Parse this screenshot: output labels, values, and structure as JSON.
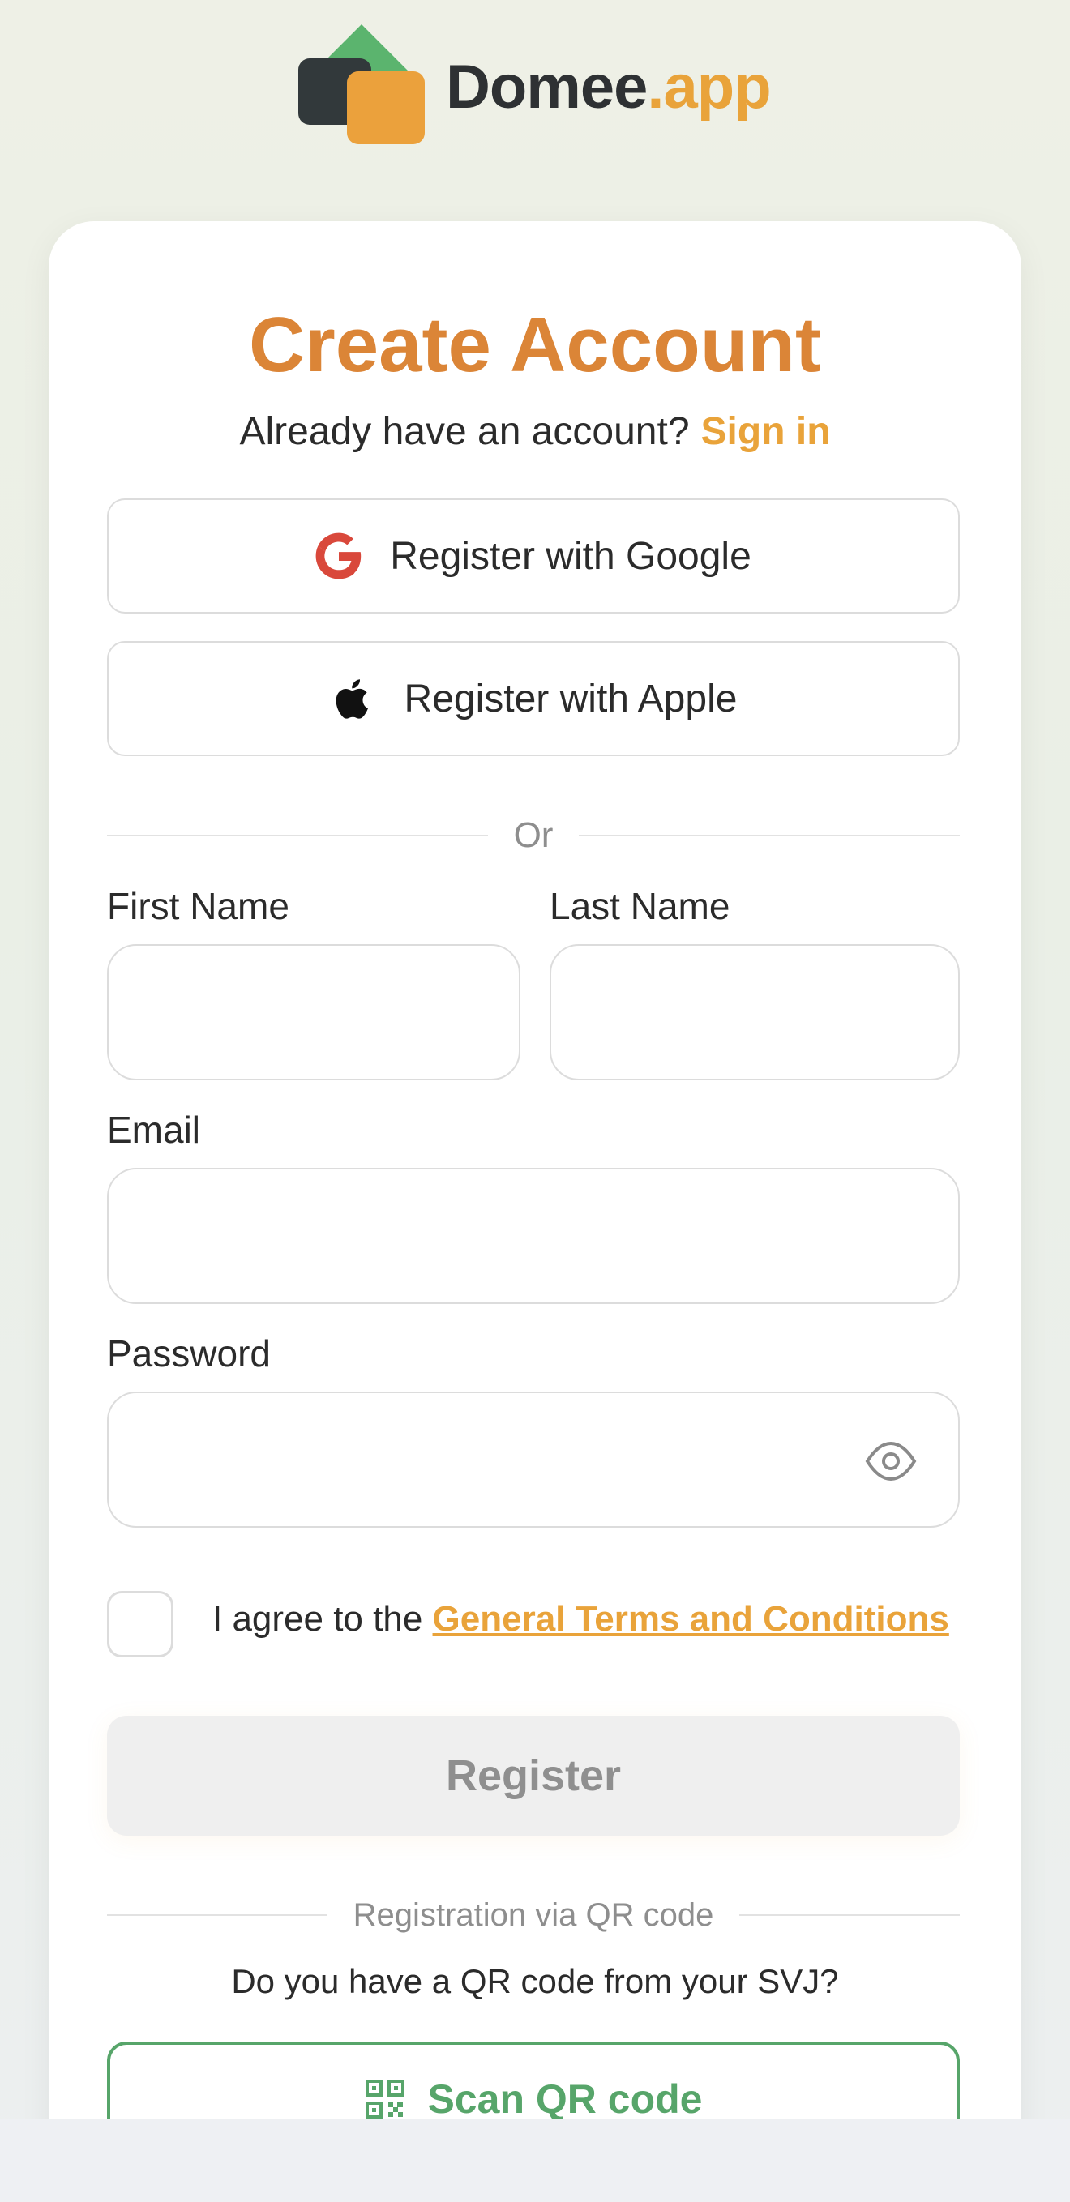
{
  "brand": {
    "name_main": "Domee",
    "name_suffix": ".app"
  },
  "header": {
    "title": "Create Account",
    "already_text": "Already have an account?",
    "sign_in_label": "Sign in"
  },
  "social": {
    "google_label": "Register with Google",
    "apple_label": "Register with Apple"
  },
  "divider_or": "Or",
  "form": {
    "first_name_label": "First Name",
    "first_name_value": "",
    "last_name_label": "Last Name",
    "last_name_value": "",
    "email_label": "Email",
    "email_value": "",
    "password_label": "Password",
    "password_value": ""
  },
  "terms": {
    "prefix": "I agree to the ",
    "link": "General Terms and Conditions",
    "checked": false
  },
  "register_label": "Register",
  "qr": {
    "divider": "Registration via QR code",
    "question": "Do you have a QR code from your SVJ?",
    "scan_label": "Scan QR code"
  },
  "colors": {
    "accent_orange": "#db8537",
    "link_orange": "#e9a33a",
    "green": "#57a56a",
    "disabled_bg": "#efefef"
  },
  "icons": [
    "domee-logo-icon",
    "google-icon",
    "apple-icon",
    "eye-icon",
    "qr-code-icon"
  ]
}
